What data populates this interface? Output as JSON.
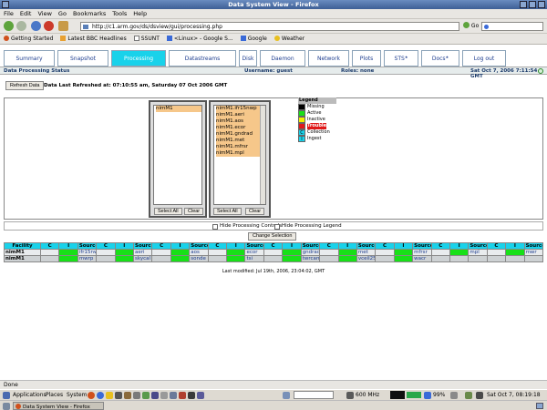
{
  "window": {
    "title": "Data System View - Firefox"
  },
  "menu": [
    "File",
    "Edit",
    "View",
    "Go",
    "Bookmarks",
    "Tools",
    "Help"
  ],
  "nav": {
    "url": "http://c1.arm.gov/ds/dsview/gui/processing.php",
    "go_label": "Go"
  },
  "bookmarks": [
    "Getting Started",
    "Latest BBC Headlines",
    "SSUNT",
    "<Linux> - Google S...",
    "Google",
    "Weather"
  ],
  "tabs": [
    {
      "label": "Summary",
      "sup": ""
    },
    {
      "label": "Snapshot",
      "sup": ""
    },
    {
      "label": "Processing",
      "sup": "",
      "active": true
    },
    {
      "label": "Datastreams",
      "sup": ""
    },
    {
      "label": "Disk",
      "sup": ""
    },
    {
      "label": "Daemon",
      "sup": ""
    },
    {
      "label": "Network",
      "sup": ""
    },
    {
      "label": "Plots",
      "sup": ""
    },
    {
      "label": "STS",
      "sup": "★"
    },
    {
      "label": "Docs",
      "sup": "★"
    },
    {
      "label": "Log out",
      "sup": ""
    }
  ],
  "status": {
    "page_title": "Data Processing Status",
    "username": "Username: guest",
    "roles": "Roles: none",
    "datetime": "Sat Oct 7, 2006 7:11:54 GMT"
  },
  "refresh": {
    "button": "Refresh Data",
    "last_refreshed": "Data Last Refreshed at: 07:10:55 am, Saturday 07 Oct 2006 GMT"
  },
  "facility_list": {
    "items": [
      "nimM1"
    ],
    "select_all": "Select All",
    "clear": "Clear"
  },
  "process_list": {
    "items": [
      "nimM1.ifr15nwp",
      "nimM1.aeri",
      "nimM1.aos",
      "nimM1.ecor",
      "nimM1.gndrad",
      "nimM1.met",
      "nimM1.mfrsr",
      "nimM1.mpl"
    ],
    "select_all": "Select All",
    "clear": "Clear"
  },
  "legend": {
    "title": "Legend",
    "items": [
      {
        "swatch": "",
        "label": "Missing",
        "color": "#000000"
      },
      {
        "swatch": "",
        "label": "Active",
        "color": "#18e018"
      },
      {
        "swatch": "",
        "label": "Inactive",
        "color": "#f0f000"
      },
      {
        "swatch": "",
        "label": "Trouble",
        "color": "#e01818"
      },
      {
        "swatch": "C",
        "label": "Collection",
        "color": "#19d2ea"
      },
      {
        "swatch": "I",
        "label": "Ingest",
        "color": "#19d2ea"
      }
    ]
  },
  "controls": {
    "hide_processing_controls": "Hide Processing Controls",
    "hide_processing_legend": "Hide Processing Legend",
    "change_selection": "Change Selection"
  },
  "facility_table": {
    "headers": {
      "facility": "Facility",
      "c": "C",
      "i": "I",
      "source": "Source"
    },
    "rows": [
      {
        "facility": "nimM1",
        "sources": [
          "ifr15nwp",
          "aeri",
          "aos",
          "ecor",
          "gndrad",
          "met",
          "mfrsr",
          "mpl",
          "mwr"
        ]
      },
      {
        "facility": "nimM1",
        "sources": [
          "mwrp",
          "skycal",
          "sonde",
          "tsi",
          "twrcam3m",
          "vceil25k",
          "wacr",
          "",
          ""
        ]
      }
    ]
  },
  "last_modified": "Last modified: Jul 19th, 2006, 23:04:02, GMT",
  "statusbar": "Done",
  "panel": {
    "menus": [
      "Applications",
      "Places",
      "System"
    ],
    "cpu": "600 MHz",
    "battery": "99%",
    "clock": "Sat Oct 7, 08:19:18"
  },
  "taskbar": {
    "window_item": "Data System View - Firefox"
  }
}
